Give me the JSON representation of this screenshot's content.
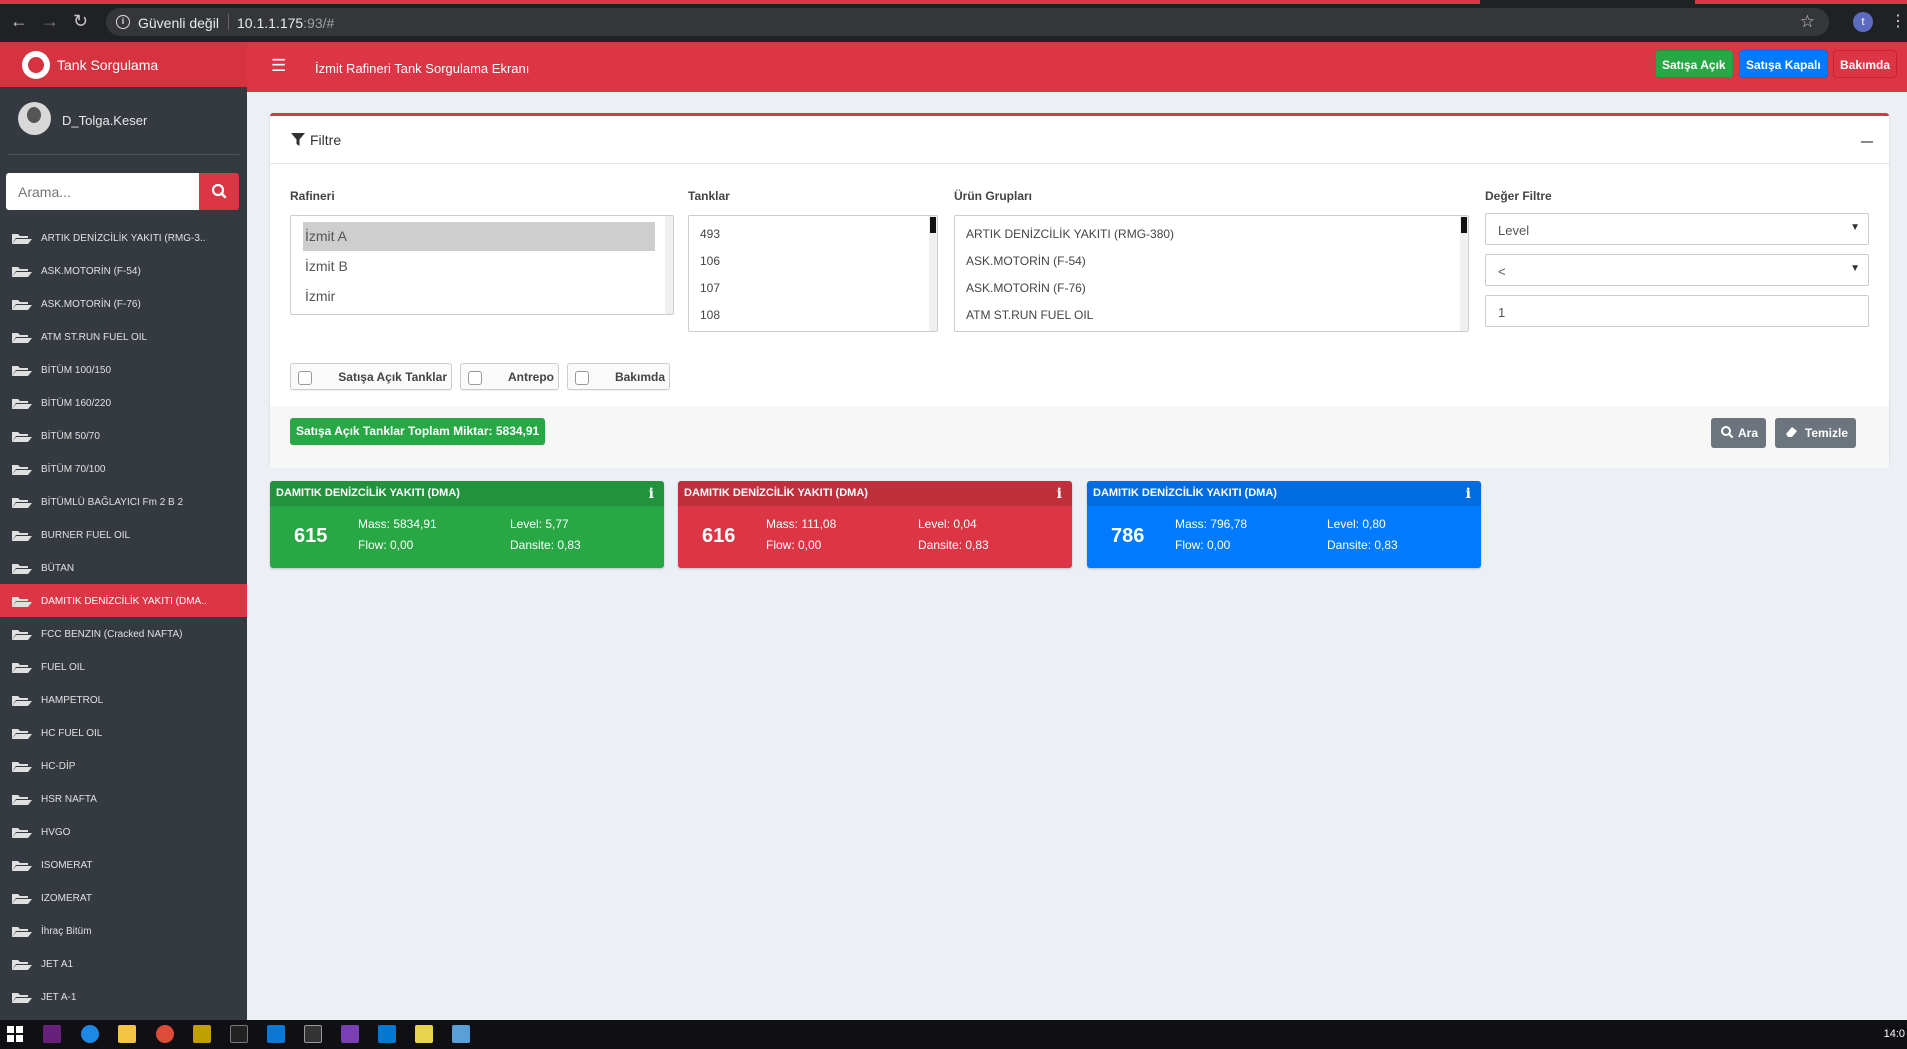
{
  "browser": {
    "security_text": "Güvenli değil",
    "url_host": "10.1.1.175",
    "url_rest": ":93/#",
    "profile_initial": "t"
  },
  "app": {
    "brand_title": "Tank Sorgulama",
    "page_title": "İzmit Rafineri Tank Sorgulama Ekranı",
    "header_buttons": {
      "open": "Satışa Açık",
      "closed": "Satışa Kapalı",
      "maintenance": "Bakımda"
    }
  },
  "sidebar": {
    "user_name": "D_Tolga.Keser",
    "search_placeholder": "Arama...",
    "items": [
      {
        "label": "ARTIK DENİZCİLİK YAKITI (RMG-3..",
        "active": false
      },
      {
        "label": "ASK.MOTORİN (F-54)",
        "active": false
      },
      {
        "label": "ASK.MOTORİN (F-76)",
        "active": false
      },
      {
        "label": "ATM ST.RUN FUEL OIL",
        "active": false
      },
      {
        "label": "BİTÜM 100/150",
        "active": false
      },
      {
        "label": "BİTÜM 160/220",
        "active": false
      },
      {
        "label": "BİTÜM 50/70",
        "active": false
      },
      {
        "label": "BİTÜM 70/100",
        "active": false
      },
      {
        "label": "BİTÜMLÜ BAĞLAYICI Fm 2 B 2",
        "active": false
      },
      {
        "label": "BURNER FUEL OIL",
        "active": false
      },
      {
        "label": "BÜTAN",
        "active": false
      },
      {
        "label": "DAMITIK DENİZCİLİK YAKITI (DMA..",
        "active": true
      },
      {
        "label": "FCC BENZIN (Cracked NAFTA)",
        "active": false
      },
      {
        "label": "FUEL OIL",
        "active": false
      },
      {
        "label": "HAMPETROL",
        "active": false
      },
      {
        "label": "HC FUEL OIL",
        "active": false
      },
      {
        "label": "HC-DİP",
        "active": false
      },
      {
        "label": "HSR NAFTA",
        "active": false
      },
      {
        "label": "HVGO",
        "active": false
      },
      {
        "label": "ISOMERAT",
        "active": false
      },
      {
        "label": "IZOMERAT",
        "active": false
      },
      {
        "label": "İhraç Bitüm",
        "active": false
      },
      {
        "label": "JET A1",
        "active": false
      },
      {
        "label": "JET A-1",
        "active": false
      }
    ]
  },
  "filter": {
    "title": "Filtre",
    "refinery_label": "Rafineri",
    "refinery_options": [
      "İzmit A",
      "İzmit B",
      "İzmir"
    ],
    "refinery_selected": "İzmit A",
    "tanks_label": "Tanklar",
    "tank_options": [
      "493",
      "106",
      "107",
      "108"
    ],
    "groups_label": "Ürün Grupları",
    "group_options": [
      "ARTIK DENİZCİLİK YAKITI (RMG-380)",
      "ASK.MOTORİN (F-54)",
      "ASK.MOTORİN (F-76)",
      "ATM ST.RUN FUEL OIL"
    ],
    "value_filter_label": "Değer Filtre",
    "value_field": "Level",
    "value_operator": "<",
    "value_input": "1",
    "checkboxes": {
      "open_tanks": "Satışa Açık Tanklar",
      "bonded": "Antrepo",
      "maintenance": "Bakımda"
    },
    "total_label": "Satışa Açık Tanklar Toplam Miktar: 5834,91",
    "search_button": "Ara",
    "clear_button": "Temizle"
  },
  "tanks": [
    {
      "product": "DAMITIK DENİZCİLİK YAKITI (DMA)",
      "number": "615",
      "mass": "Mass: 5834,91",
      "level": "Level: 5,77",
      "flow": "Flow: 0,00",
      "density": "Dansite: 0,83",
      "color": "#28a745"
    },
    {
      "product": "DAMITIK DENİZCİLİK YAKITI (DMA)",
      "number": "616",
      "mass": "Mass: 111,08",
      "level": "Level: 0,04",
      "flow": "Flow: 0,00",
      "density": "Dansite: 0,83",
      "color": "#dc3545"
    },
    {
      "product": "DAMITIK DENİZCİLİK YAKITI (DMA)",
      "number": "786",
      "mass": "Mass: 796,78",
      "level": "Level: 0,80",
      "flow": "Flow: 0,00",
      "density": "Dansite: 0,83",
      "color": "#007bff"
    }
  ],
  "taskbar": {
    "clock": "14:0"
  },
  "colors": {
    "primary_red": "#dc3545",
    "success_green": "#28a745",
    "primary_blue": "#007bff",
    "sidebar_bg": "#343a40"
  }
}
